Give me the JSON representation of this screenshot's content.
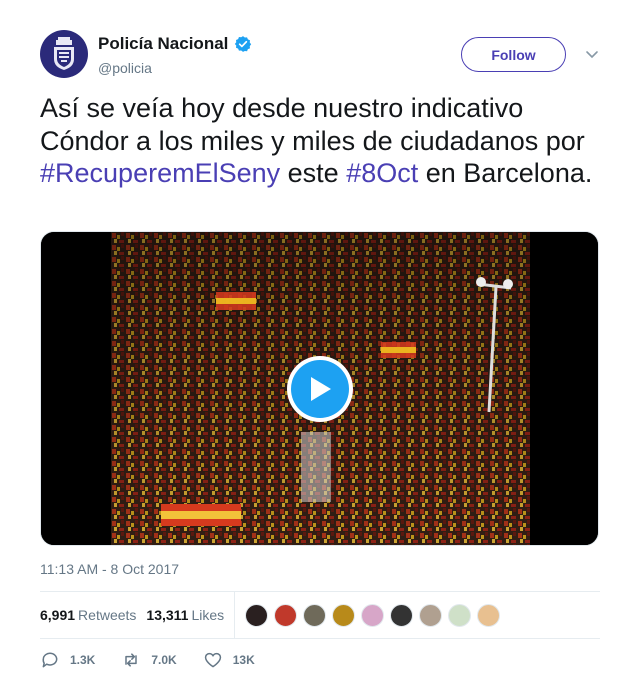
{
  "author": {
    "display_name": "Policía Nacional",
    "handle": "@policia",
    "verified_icon": "verified-badge-icon",
    "avatar_icon": "police-emblem-icon"
  },
  "follow_label": "Follow",
  "tweet": {
    "segments": [
      {
        "text": "Así se veía hoy desde nuestro indicativo Cóndor a los miles y miles de ciudadanos por ",
        "type": "text"
      },
      {
        "text": "#RecuperemElSeny",
        "type": "hashtag"
      },
      {
        "text": " este ",
        "type": "text"
      },
      {
        "text": "#8Oct",
        "type": "hashtag"
      },
      {
        "text": "  en Barcelona.",
        "type": "text"
      }
    ]
  },
  "media": {
    "type": "video",
    "play_icon": "play-icon"
  },
  "timestamp": "11:13 AM - 8 Oct 2017",
  "stats": {
    "retweets_count": "6,991",
    "retweets_label": "Retweets",
    "likes_count": "13,311",
    "likes_label": "Likes"
  },
  "likers": [
    "#2a2020",
    "#c0392b",
    "#6f6a5a",
    "#b88a1a",
    "#d7a6c8",
    "#333333",
    "#b0a090",
    "#cfe0c8",
    "#e8c090"
  ],
  "actions": {
    "reply_count": "1.3K",
    "retweet_count": "7.0K",
    "like_count": "13K"
  },
  "colors": {
    "link": "#4a3fb4",
    "play": "#1da1f2",
    "muted": "#657786"
  }
}
